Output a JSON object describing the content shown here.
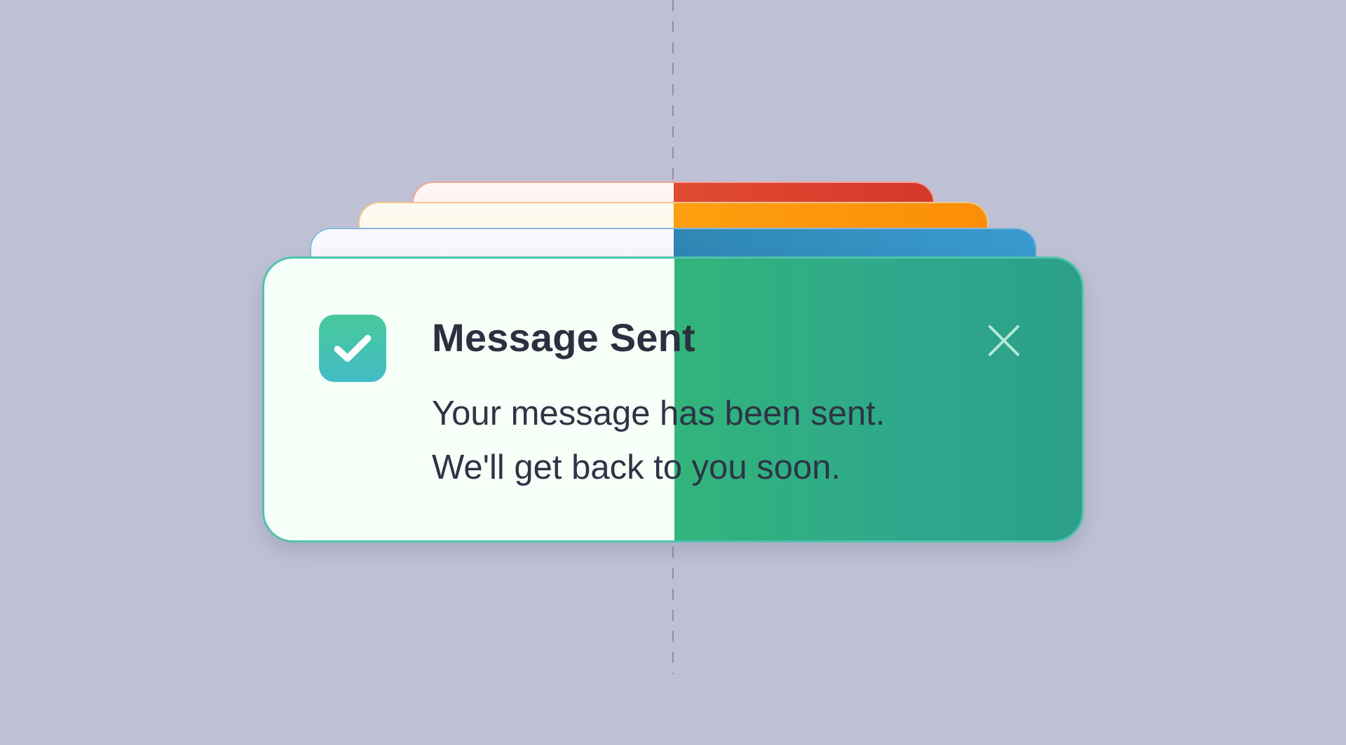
{
  "notification": {
    "title": "Message Sent",
    "message_lines": [
      "Your message has been sent.",
      "We'll get back to you soon."
    ],
    "status_icon": "check-icon",
    "close_icon": "close-icon"
  },
  "stacked_toasts": [
    {
      "type": "error",
      "accent": "#df4431"
    },
    {
      "type": "warning",
      "accent": "#ff9b0a"
    },
    {
      "type": "info",
      "accent": "#3292c4"
    }
  ],
  "colors": {
    "page_background": "#bec0d4",
    "success": "#2fb286",
    "success_light": "#f6fff8",
    "text_dark": "#2b2f3e",
    "text_light": "#ffffff"
  }
}
